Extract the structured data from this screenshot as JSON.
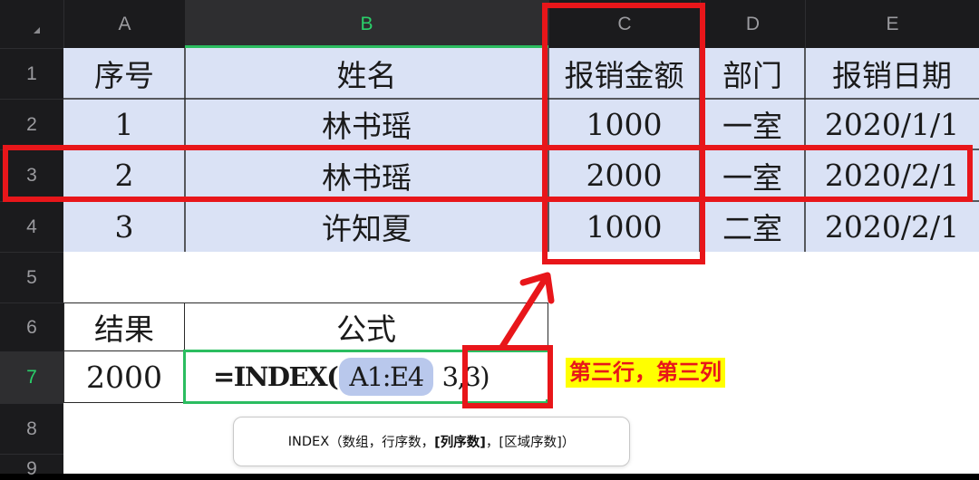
{
  "corner_icon": "select-all-triangle-icon",
  "columns": [
    "A",
    "B",
    "C",
    "D",
    "E"
  ],
  "rows": [
    "1",
    "2",
    "3",
    "4",
    "5",
    "6",
    "7",
    "8",
    "9"
  ],
  "table": {
    "header": [
      "序号",
      "姓名",
      "报销金额",
      "部门",
      "报销日期"
    ],
    "rows": [
      [
        "1",
        "林书瑶",
        "1000",
        "一室",
        "2020/1/1"
      ],
      [
        "2",
        "林书瑶",
        "2000",
        "一室",
        "2020/2/1"
      ],
      [
        "3",
        "许知夏",
        "1000",
        "二室",
        "2020/2/1"
      ]
    ]
  },
  "result": {
    "label": "结果",
    "formula_label": "公式",
    "value": "2000",
    "formula_prefix": "=INDEX(",
    "formula_range": "A1:E4",
    "formula_args": "3,3)"
  },
  "annotation": {
    "text": "第三行，第三列"
  },
  "tooltip": {
    "fn": "INDEX",
    "open": "（",
    "arg1": "数组",
    "sep1": "，",
    "arg2": "行序数",
    "sep2": "，",
    "arg3": "[列序数]",
    "sep3": "，",
    "arg4": "[区域序数]",
    "close": "）"
  },
  "colors": {
    "table_fill": "#dae2f5",
    "highlight_red": "#e8161a",
    "selection_green": "#2bbd60",
    "annotation_bg": "#ffff00",
    "formula_range_bg": "#b9c8ec"
  }
}
